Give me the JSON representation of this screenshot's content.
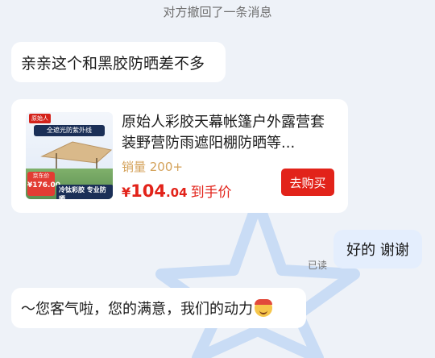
{
  "system_note": "对方撤回了一条消息",
  "messages": {
    "incoming_1": "亲亲这个和黑胶防晒差不多",
    "outgoing_1": "好的 谢谢",
    "outgoing_1_status": "已读",
    "incoming_2": "～您客气啦，您的满意，我们的动力"
  },
  "product_card": {
    "title": "原始人彩胶天幕帐篷户外露营套装野营防雨遮阳棚防晒等...",
    "sales": "销量 200+",
    "price_symbol": "¥",
    "price_integer": "104",
    "price_decimal": ".04",
    "price_suffix": "到手价",
    "buy_label": "去购买",
    "thumb": {
      "brand": "原始人",
      "banner": "全遮光防紫外线",
      "promo_label": "京东价",
      "promo_price": "¥176.00",
      "footer": "冷钛彩胶 专业防晒"
    }
  },
  "colors": {
    "accent": "#e2231a",
    "sales": "#d4a25a",
    "bubble_out": "#e4eefd"
  }
}
